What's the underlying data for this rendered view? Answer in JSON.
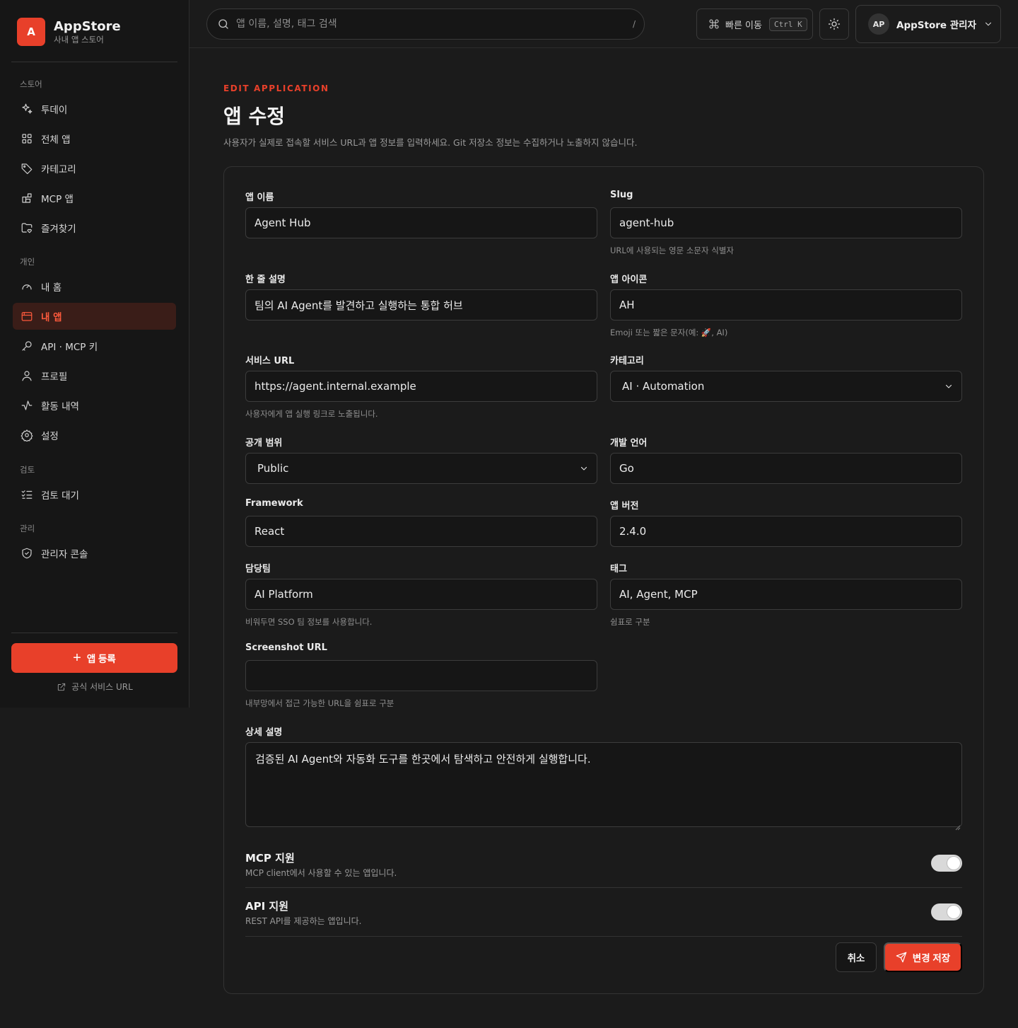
{
  "brand": {
    "logo_letter": "A",
    "name": "AppStore",
    "subtitle": "사내 앱 스토어",
    "accent_color": "#e8402a"
  },
  "sidebar": {
    "sections": [
      {
        "title": "스토어",
        "items": [
          {
            "label": "투데이",
            "icon": "sparkles-icon"
          },
          {
            "label": "전체 앱",
            "icon": "grid-icon"
          },
          {
            "label": "카테고리",
            "icon": "tag-icon"
          },
          {
            "label": "MCP 앱",
            "icon": "blocks-icon"
          },
          {
            "label": "즐겨찾기",
            "icon": "folder-heart-icon"
          }
        ]
      },
      {
        "title": "개인",
        "items": [
          {
            "label": "내 홈",
            "icon": "gauge-icon"
          },
          {
            "label": "내 앱",
            "icon": "app-window-icon",
            "active": true
          },
          {
            "label": "API · MCP 키",
            "icon": "key-icon"
          },
          {
            "label": "프로필",
            "icon": "user-icon"
          },
          {
            "label": "활동 내역",
            "icon": "activity-icon"
          },
          {
            "label": "설정",
            "icon": "gear-icon"
          }
        ]
      },
      {
        "title": "검토",
        "items": [
          {
            "label": "검토 대기",
            "icon": "list-checks-icon"
          }
        ]
      },
      {
        "title": "관리",
        "items": [
          {
            "label": "관리자 콘솔",
            "icon": "shield-check-icon"
          }
        ]
      }
    ],
    "register_button": "앱 등록",
    "official_link": "공식 서비스 URL"
  },
  "topbar": {
    "search_placeholder": "앱 이름, 설명, 태그 검색",
    "search_shortcut": "/",
    "quick_nav_label": "빠른 이동",
    "quick_nav_kbd": "Ctrl K",
    "user_initials": "AP",
    "user_name": "AppStore 관리자"
  },
  "header": {
    "eyebrow": "EDIT APPLICATION",
    "title": "앱 수정",
    "description": "사용자가 실제로 접속할 서비스 URL과 앱 정보를 입력하세요. Git 저장소 정보는 수집하거나 노출하지 않습니다."
  },
  "form": {
    "app_name": {
      "label": "앱 이름",
      "value": "Agent Hub"
    },
    "slug": {
      "label": "Slug",
      "value": "agent-hub",
      "hint": "URL에 사용되는 영문 소문자 식별자"
    },
    "summary": {
      "label": "한 줄 설명",
      "value": "팀의 AI Agent를 발견하고 실행하는 통합 허브"
    },
    "icon": {
      "label": "앱 아이콘",
      "value": "AH",
      "hint": "Emoji 또는 짧은 문자(예: 🚀, AI)"
    },
    "service_url": {
      "label": "서비스 URL",
      "value": "https://agent.internal.example",
      "hint": "사용자에게 앱 실행 링크로 노출됩니다."
    },
    "category": {
      "label": "카테고리",
      "value": "AI · Automation"
    },
    "visibility": {
      "label": "공개 범위",
      "value": "Public"
    },
    "language": {
      "label": "개발 언어",
      "value": "Go"
    },
    "framework": {
      "label": "Framework",
      "value": "React"
    },
    "version": {
      "label": "앱 버전",
      "value": "2.4.0"
    },
    "team": {
      "label": "담당팀",
      "value": "AI Platform",
      "hint": "비워두면 SSO 팀 정보를 사용합니다."
    },
    "tags": {
      "label": "태그",
      "value": "AI, Agent, MCP",
      "hint": "쉼표로 구분"
    },
    "screenshot_url": {
      "label": "Screenshot URL",
      "value": "",
      "hint": "내부망에서 접근 가능한 URL을 쉼표로 구분"
    },
    "description": {
      "label": "상세 설명",
      "value": "검증된 AI Agent와 자동화 도구를 한곳에서 탐색하고 안전하게 실행합니다."
    },
    "mcp_support": {
      "title": "MCP 지원",
      "desc": "MCP client에서 사용할 수 있는 앱입니다.",
      "enabled": true
    },
    "api_support": {
      "title": "API 지원",
      "desc": "REST API를 제공하는 앱입니다.",
      "enabled": true
    },
    "cancel_label": "취소",
    "save_label": "변경 저장"
  }
}
